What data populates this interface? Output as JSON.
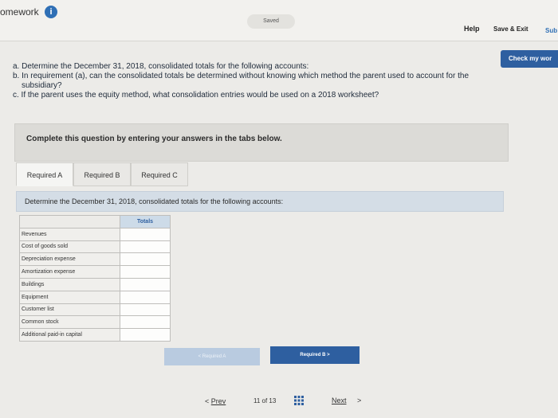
{
  "header": {
    "brand": "omework",
    "saved": "Saved",
    "help": "Help",
    "save_exit": "Save & Exit",
    "submit": "Sub"
  },
  "check_button": "Check my wor",
  "questions": {
    "a": "a. Determine the December 31, 2018, consolidated totals for the following accounts:",
    "b_line1": "b. In requirement (a), can the consolidated totals be determined without knowing which method the parent used to account for the",
    "b_line2": "subsidiary?",
    "c": "c. If the parent uses the equity method, what consolidation entries would be used on a 2018 worksheet?"
  },
  "instruction": "Complete this question by entering your answers in the tabs below.",
  "tabs": [
    {
      "label": "Required A"
    },
    {
      "label": "Required B"
    },
    {
      "label": "Required C"
    }
  ],
  "prompt": "Determine the December 31, 2018, consolidated totals for the following accounts:",
  "table": {
    "column_header": "Totals",
    "rows": [
      "Revenues",
      "Cost of goods sold",
      "Depreciation expense",
      "Amortization expense",
      "Buildings",
      "Equipment",
      "Customer list",
      "Common stock",
      "Additional paid-in capital"
    ]
  },
  "nav_buttons": {
    "prev_label": "< Required A",
    "next_label": "Required B >"
  },
  "pager": {
    "prev": "Prev",
    "count": "11 of 13",
    "next": "Next"
  },
  "colors": {
    "accent": "#2e5fa0",
    "info": "#2f6fb5"
  }
}
